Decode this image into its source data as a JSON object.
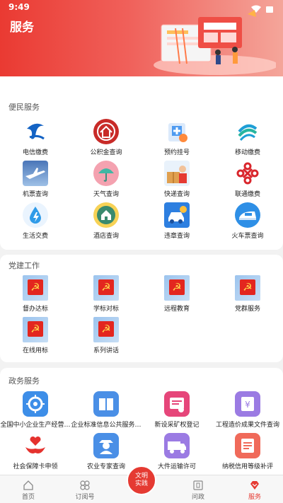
{
  "status_bar": {
    "time": "9:49"
  },
  "page_title": "服务",
  "sections": {
    "services": {
      "title": "便民服务",
      "items": [
        {
          "label": "电信缴费",
          "icon": "china-telecom-icon"
        },
        {
          "label": "公积金查询",
          "icon": "housing-fund-icon"
        },
        {
          "label": "预约挂号",
          "icon": "hospital-booking-icon"
        },
        {
          "label": "移动缴费",
          "icon": "china-mobile-icon"
        },
        {
          "label": "机票查询",
          "icon": "airplane-icon"
        },
        {
          "label": "天气查询",
          "icon": "umbrella-icon"
        },
        {
          "label": "快递查询",
          "icon": "courier-icon"
        },
        {
          "label": "联通缴费",
          "icon": "china-unicom-icon"
        },
        {
          "label": "生活交费",
          "icon": "water-drop-icon"
        },
        {
          "label": "酒店查询",
          "icon": "hotel-icon"
        },
        {
          "label": "违章查询",
          "icon": "traffic-violation-icon"
        },
        {
          "label": "火车票查询",
          "icon": "high-speed-train-icon"
        }
      ]
    },
    "party": {
      "title": "党建工作",
      "items": [
        {
          "label": "督办达标",
          "icon": "party-flag-icon"
        },
        {
          "label": "学标对标",
          "icon": "party-flag-icon"
        },
        {
          "label": "远程教育",
          "icon": "party-flag-icon"
        },
        {
          "label": "党群服务",
          "icon": "party-flag-icon"
        },
        {
          "label": "在线用标",
          "icon": "party-flag-icon"
        },
        {
          "label": "系列讲话",
          "icon": "party-flag-icon"
        }
      ]
    },
    "gov": {
      "title": "政务服务",
      "items": [
        {
          "label": "全国中小企业生产经营…",
          "icon": "target-icon",
          "color": "#3d8ee8",
          "glyph": "◎"
        },
        {
          "label": "企业标准信息公共服务…",
          "icon": "book-icon",
          "color": "#4a8fe6",
          "glyph": "▤"
        },
        {
          "label": "新设采矿权登记",
          "icon": "certificate-icon",
          "color": "#e6467a",
          "glyph": "▦"
        },
        {
          "label": "工程造价成果文件查询",
          "icon": "money-document-icon",
          "color": "#9b7be3",
          "glyph": "¥"
        },
        {
          "label": "社会保障卡申领",
          "icon": "hands-heart-icon",
          "color": "#ffffff",
          "glyph": "♥"
        },
        {
          "label": "农业专家查询",
          "icon": "farmer-icon",
          "color": "#4a8fe6",
          "glyph": "☺"
        },
        {
          "label": "大件运输许可",
          "icon": "truck-icon",
          "color": "#9b7be3",
          "glyph": "▬"
        },
        {
          "label": "纳税信用等级补评",
          "icon": "tax-document-icon",
          "color": "#f06a5a",
          "glyph": "▭"
        }
      ]
    }
  },
  "tabbar": {
    "tabs": [
      {
        "label": "首页",
        "icon": "home-icon"
      },
      {
        "label": "订阅号",
        "icon": "subscription-icon"
      },
      {
        "label": "问政",
        "icon": "inquiry-icon"
      },
      {
        "label": "服务",
        "icon": "service-icon"
      }
    ],
    "center": {
      "line1": "文明",
      "line2": "实践"
    }
  },
  "colors": {
    "brand": "#e53a32"
  }
}
